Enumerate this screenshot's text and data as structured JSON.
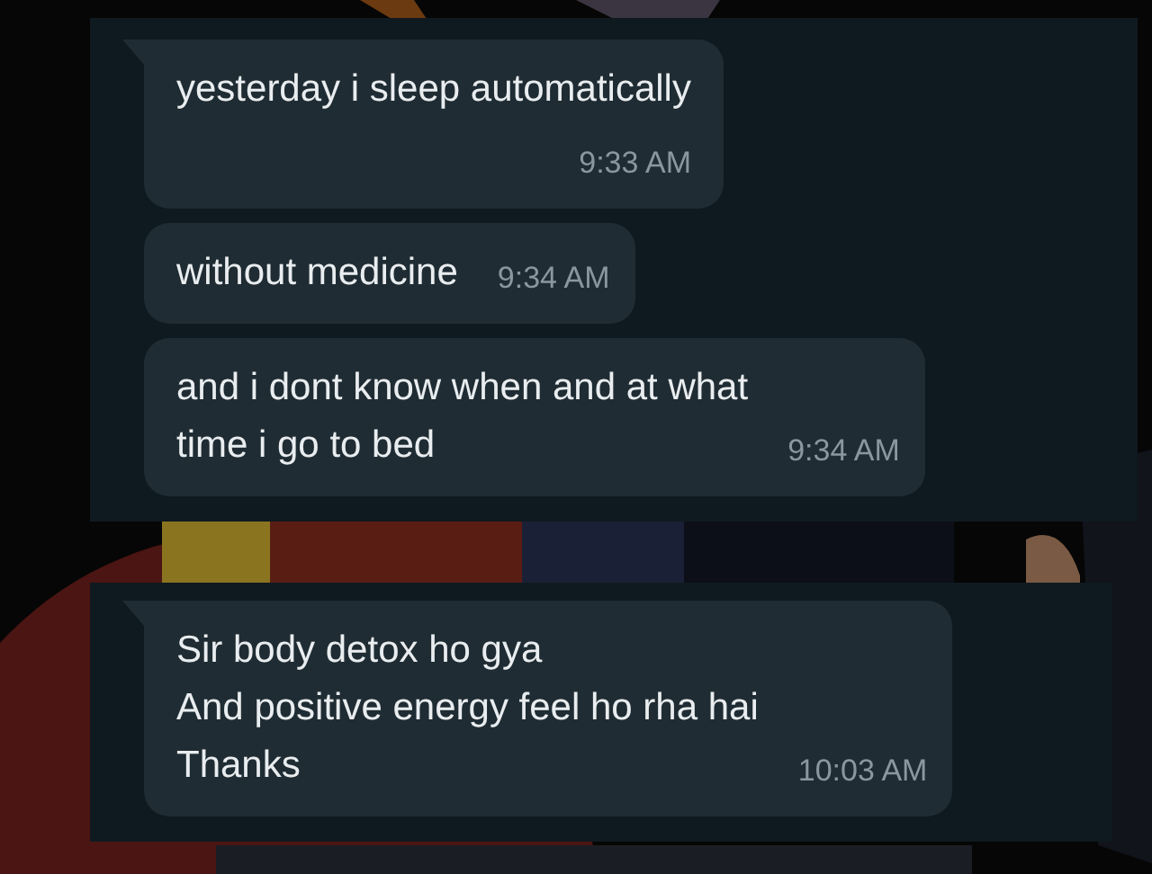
{
  "panels": [
    {
      "messages": [
        {
          "kind": "stacked",
          "lines": [
            "yesterday i sleep automatically"
          ],
          "time": "9:33 AM",
          "tail": true
        },
        {
          "kind": "inline",
          "lines": [
            "without medicine"
          ],
          "time": "9:34 AM",
          "tail": false
        },
        {
          "kind": "inline",
          "lines": [
            "and i dont know when and at what",
            "time i go to bed"
          ],
          "time": "9:34 AM",
          "tail": false
        }
      ]
    },
    {
      "messages": [
        {
          "kind": "inline",
          "lines": [
            "Sir body detox ho gya",
            "And positive energy feel ho rha hai",
            "Thanks"
          ],
          "time": "10:03 AM",
          "tail": true
        }
      ]
    }
  ]
}
